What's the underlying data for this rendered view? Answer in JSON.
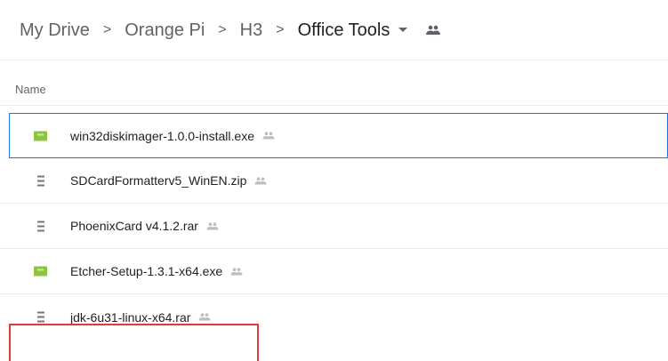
{
  "breadcrumb": {
    "items": [
      "My Drive",
      "Orange Pi",
      "H3"
    ],
    "current": "Office Tools",
    "separator": ">",
    "dropdown_icon": "arrow-drop-down-icon",
    "shared_icon": "people-icon"
  },
  "list": {
    "column_name": "Name",
    "files": [
      {
        "name": "win32diskimager-1.0.0-install.exe",
        "type": "exe",
        "icon": "executable-icon",
        "shared": true
      },
      {
        "name": "SDCardFormatterv5_WinEN.zip",
        "type": "archive",
        "icon": "archive-icon",
        "shared": true
      },
      {
        "name": "PhoenixCard v4.1.2.rar",
        "type": "archive",
        "icon": "archive-icon",
        "shared": true
      },
      {
        "name": "Etcher-Setup-1.3.1-x64.exe",
        "type": "exe",
        "icon": "executable-icon",
        "shared": true
      },
      {
        "name": "jdk-6u31-linux-x64.rar",
        "type": "archive",
        "icon": "archive-icon",
        "shared": true
      }
    ]
  },
  "colors": {
    "selection_border": "#1a73e8",
    "highlight_box": "#e53935",
    "exe_icon": "#8cc63f",
    "archive_icon": "#757575"
  }
}
